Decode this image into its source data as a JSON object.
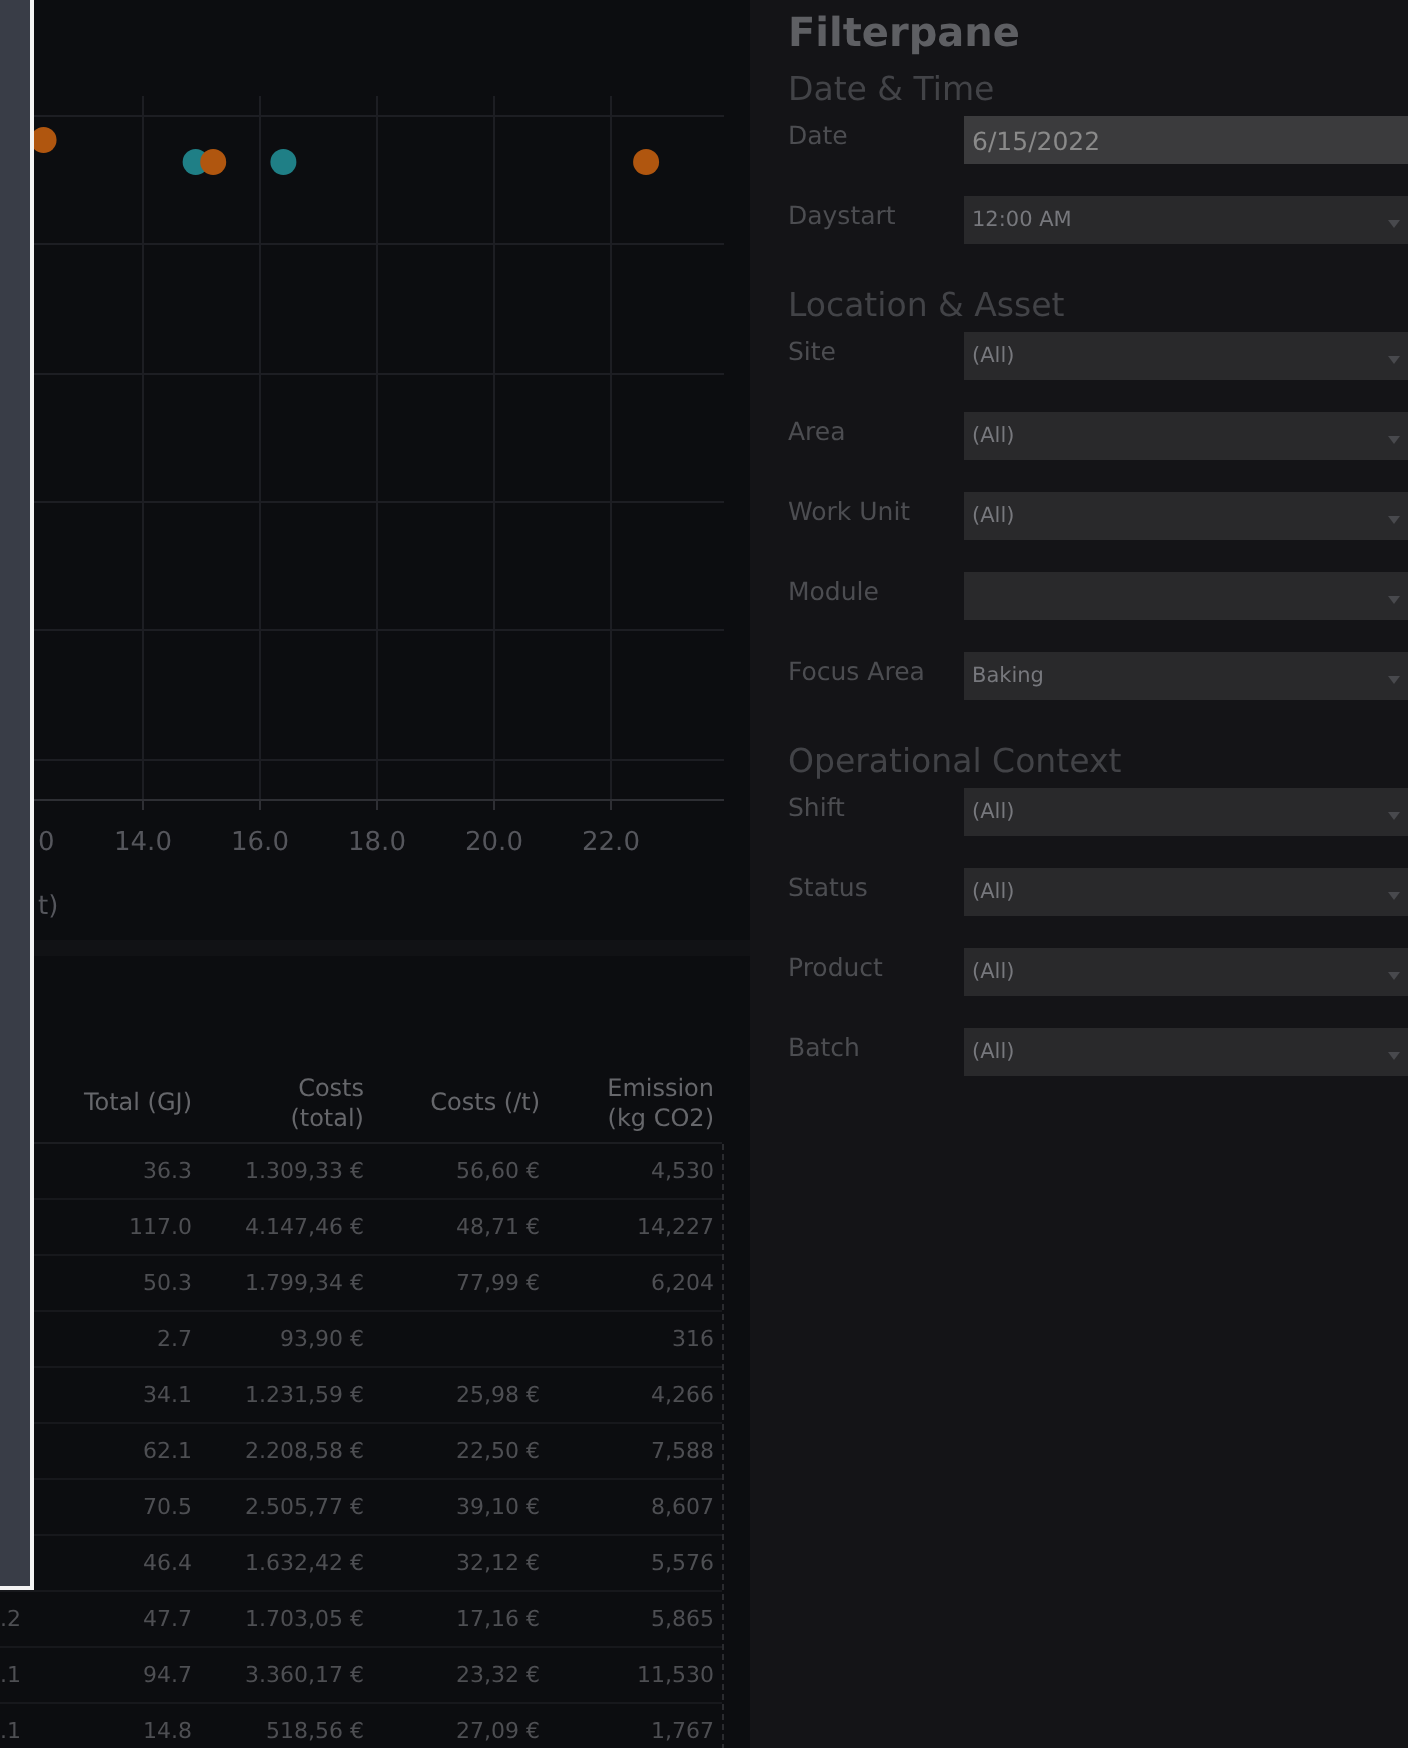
{
  "chart": {
    "tick_labels": [
      "0",
      "14.0",
      "16.0",
      "18.0",
      "20.0",
      "22.0"
    ],
    "axis_title": "t)"
  },
  "table": {
    "columns": [
      "Total (GJ)",
      "Costs\n(total)",
      "Costs (/t)",
      "Emission\n(kg CO2)"
    ],
    "rows": [
      {
        "total": "36.3",
        "costs_total": "1.309,33 €",
        "costs_per_t": "56,60 €",
        "emission": "4,530"
      },
      {
        "total": "117.0",
        "costs_total": "4.147,46 €",
        "costs_per_t": "48,71 €",
        "emission": "14,227"
      },
      {
        "total": "50.3",
        "costs_total": "1.799,34 €",
        "costs_per_t": "77,99 €",
        "emission": "6,204"
      },
      {
        "total": "2.7",
        "costs_total": "93,90 €",
        "emission": "316"
      },
      {
        "total": "34.1",
        "costs_total": "1.231,59 €",
        "costs_per_t": "25,98 €",
        "emission": "4,266"
      },
      {
        "total": "62.1",
        "costs_total": "2.208,58 €",
        "costs_per_t": "22,50 €",
        "emission": "7,588"
      },
      {
        "total": "70.5",
        "costs_total": "2.505,77 €",
        "costs_per_t": "39,10 €",
        "emission": "8,607"
      },
      {
        "total": "46.4",
        "costs_total": "1.632,42 €",
        "costs_per_t": "32,12 €",
        "emission": "5,576"
      },
      {
        "column_1": ".2",
        "total": "47.7",
        "costs_total": "1.703,05 €",
        "costs_per_t": "17,16 €",
        "emission": "5,865"
      },
      {
        "column_1": ".1",
        "total": "94.7",
        "costs_total": "3.360,17 €",
        "costs_per_t": "23,32 €",
        "emission": "11,530"
      },
      {
        "column_1": ".1",
        "total": "14.8",
        "costs_total": "518,56 €",
        "costs_per_t": "27,09 €",
        "emission": "1,767"
      }
    ]
  },
  "filterpane": {
    "title": "Filterpane",
    "sections": [
      {
        "title": "Date & Time",
        "fields": [
          {
            "label": "Date",
            "kind": "date",
            "value": "6/15/2022"
          },
          {
            "label": "Daystart",
            "kind": "select",
            "value": "12:00 AM"
          }
        ]
      },
      {
        "title": "Location & Asset",
        "fields": [
          {
            "label": "Site",
            "kind": "select",
            "value": "(All)"
          },
          {
            "label": "Area",
            "kind": "select",
            "value": "(All)"
          },
          {
            "label": "Work Unit",
            "kind": "select",
            "value": "(All)"
          },
          {
            "label": "Module",
            "kind": "select"
          },
          {
            "label": "Focus Area",
            "kind": "select",
            "value": "Baking"
          }
        ]
      },
      {
        "title": "Operational Context",
        "fields": [
          {
            "label": "Shift",
            "kind": "select",
            "value": "(All)"
          },
          {
            "label": "Status",
            "kind": "select",
            "value": "(All)"
          },
          {
            "label": "Product",
            "kind": "select",
            "value": "(All)"
          },
          {
            "label": "Batch",
            "kind": "select",
            "value": "(All)"
          }
        ]
      }
    ]
  }
}
